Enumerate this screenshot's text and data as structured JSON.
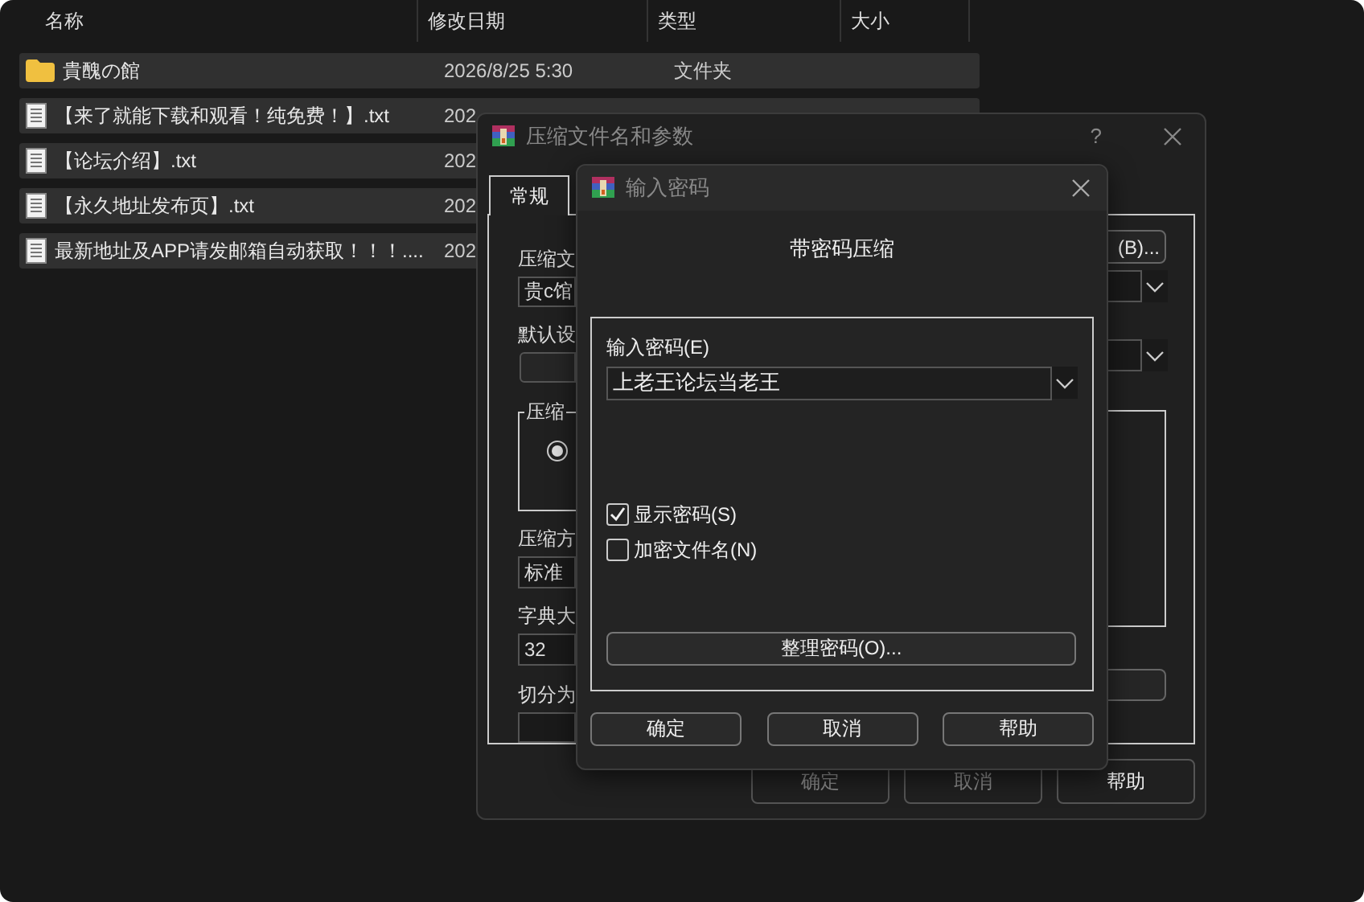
{
  "file_list": {
    "columns": [
      {
        "label": "名称"
      },
      {
        "label": "修改日期"
      },
      {
        "label": "类型"
      },
      {
        "label": "大小"
      }
    ],
    "rows": [
      {
        "kind": "folder",
        "name": "貴醜の館",
        "date": "2026/8/25 5:30",
        "type": "文件夹",
        "selected": true
      },
      {
        "kind": "text",
        "name": "【来了就能下载和观看！纯免费！】.txt",
        "date": "202",
        "selected": true
      },
      {
        "kind": "text",
        "name": "【论坛介绍】.txt",
        "date": "202",
        "selected": true
      },
      {
        "kind": "text",
        "name": "【永久地址发布页】.txt",
        "date": "202",
        "selected": true
      },
      {
        "kind": "text",
        "name": "最新地址及APP请发邮箱自动获取！！！....",
        "date": "202",
        "selected": true
      }
    ]
  },
  "archive_dialog": {
    "title": "压缩文件名和参数",
    "help": "?",
    "tabs": [
      {
        "label": "常规",
        "selected": true
      }
    ],
    "archive_name_label": "压缩文",
    "archive_name_value": "贵c馆",
    "browse_button": "(B)...",
    "profile_label": "默认设",
    "format_group_label": "压缩",
    "format_radio_selected": true,
    "method_label": "压缩方",
    "method_value": "标准",
    "dictionary_label": "字典大",
    "dictionary_value": "32",
    "split_label": "切分为",
    "buttons": [
      {
        "label": "确定",
        "disabled": true
      },
      {
        "label": "取消",
        "disabled": true
      },
      {
        "label": "帮助",
        "disabled": false
      }
    ]
  },
  "password_dialog": {
    "title": "输入密码",
    "heading": "带密码压缩",
    "password_label": "输入密码(E)",
    "password_value": "上老王论坛当老王",
    "options": [
      {
        "label": "显示密码(S)",
        "checked": true
      },
      {
        "label": "加密文件名(N)",
        "checked": false
      }
    ],
    "organize_button": "整理密码(O)...",
    "buttons": [
      {
        "label": "确定"
      },
      {
        "label": "取消"
      },
      {
        "label": "帮助"
      }
    ]
  }
}
